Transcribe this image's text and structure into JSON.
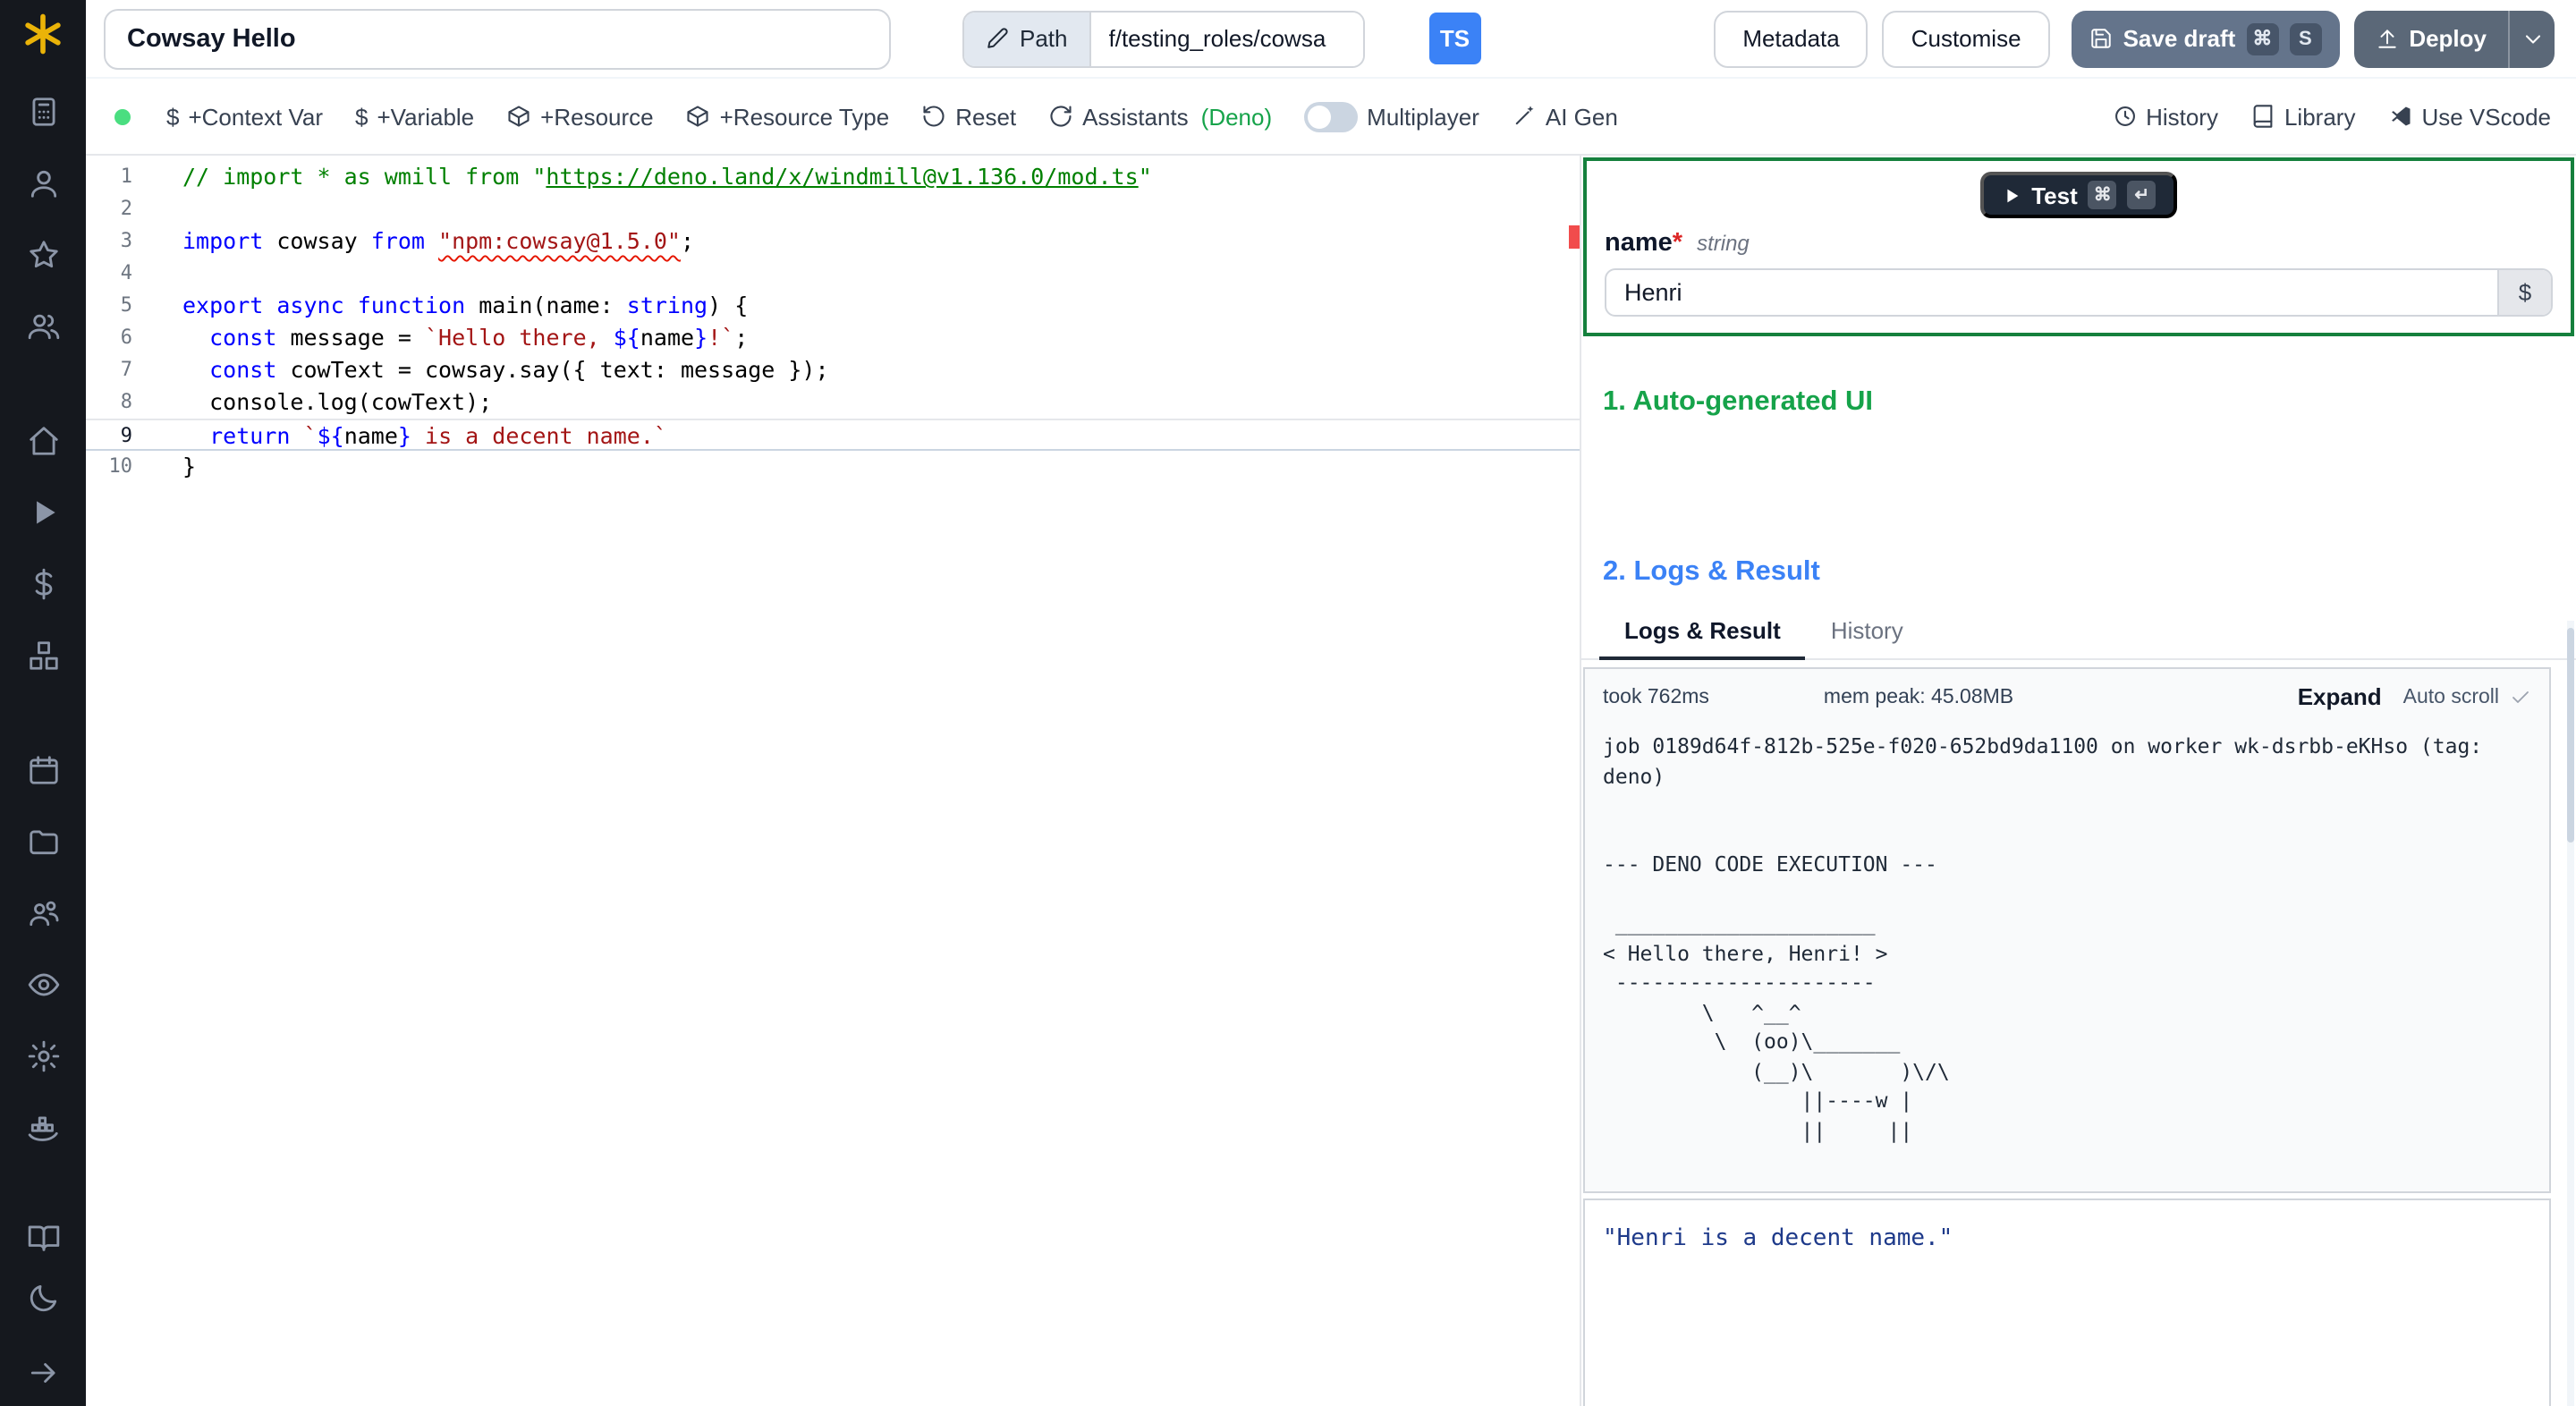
{
  "topbar": {
    "script_name": "Cowsay Hello",
    "path_label": "Path",
    "path_value": "f/testing_roles/cowsa",
    "language_badge": "TS",
    "metadata": "Metadata",
    "customise": "Customise",
    "save_draft": "Save draft",
    "save_kbd": [
      "⌘",
      "S"
    ],
    "deploy": "Deploy"
  },
  "toolbar": {
    "context_var": "+Context Var",
    "variable": "+Variable",
    "resource": "+Resource",
    "resource_type": "+Resource Type",
    "reset": "Reset",
    "assistants": "Assistants",
    "assistants_lang": "(Deno)",
    "multiplayer": "Multiplayer",
    "ai_gen": "AI Gen",
    "history": "History",
    "library": "Library",
    "use_vscode": "Use VScode"
  },
  "editor": {
    "active_line": 9,
    "lines": [
      [
        [
          "// import * as wmill from \"",
          "cm"
        ],
        [
          "https://deno.land/x/windmill@v1.136.0/mod.ts",
          "cm u"
        ],
        [
          "\"",
          "cm"
        ]
      ],
      [],
      [
        [
          "import",
          "kw"
        ],
        [
          " cowsay ",
          "id"
        ],
        [
          "from",
          "kw"
        ],
        [
          " ",
          "id"
        ],
        [
          "\"npm:cowsay@1.5.0\"",
          "str sq"
        ],
        [
          ";",
          "id"
        ]
      ],
      [],
      [
        [
          "export",
          "kw"
        ],
        [
          " ",
          "id"
        ],
        [
          "async",
          "kw"
        ],
        [
          " ",
          "id"
        ],
        [
          "function",
          "kw"
        ],
        [
          " main(name: ",
          "id"
        ],
        [
          "string",
          "kw"
        ],
        [
          ") {",
          "id"
        ]
      ],
      [
        [
          "  ",
          "id"
        ],
        [
          "const",
          "kw"
        ],
        [
          " message = ",
          "id"
        ],
        [
          "`Hello there, ",
          "str"
        ],
        [
          "${",
          "kw"
        ],
        [
          "name",
          "id"
        ],
        [
          "}",
          "kw"
        ],
        [
          "!`",
          "str"
        ],
        [
          ";",
          "id"
        ]
      ],
      [
        [
          "  ",
          "id"
        ],
        [
          "const",
          "kw"
        ],
        [
          " cowText = cowsay.say({ text: message });",
          "id"
        ]
      ],
      [
        [
          "  console.log(cowText);",
          "id"
        ]
      ],
      [
        [
          "  ",
          "id"
        ],
        [
          "return",
          "kw"
        ],
        [
          " ",
          "id"
        ],
        [
          "`",
          "str"
        ],
        [
          "${",
          "kw"
        ],
        [
          "name",
          "id"
        ],
        [
          "}",
          "kw"
        ],
        [
          " is a decent name.`",
          "str"
        ]
      ],
      [
        [
          "}",
          "id"
        ]
      ]
    ]
  },
  "run_panel": {
    "test_label": "Test",
    "test_kbd": [
      "⌘",
      "↵"
    ],
    "field_name": "name",
    "field_required": "*",
    "field_type": "string",
    "field_value": "Henri",
    "var_picker": "$",
    "section1": "1. Auto-generated UI",
    "section2": "2. Logs & Result",
    "tabs": [
      "Logs & Result",
      "History"
    ],
    "active_tab": "Logs & Result",
    "took": "took 762ms",
    "mem": "mem peak: 45.08MB",
    "expand": "Expand",
    "autoscroll": "Auto scroll",
    "log_text": "job 0189d64f-812b-525e-f020-652bd9da1100 on worker wk-dsrbb-eKHso (tag:\ndeno)\n\n\n--- DENO CODE EXECUTION ---\n\n _____________________\n< Hello there, Henri! >\n ---------------------\n        \\   ^__^\n         \\  (oo)\\_______\n            (__)\\       )\\/\\\n                ||----w |\n                ||     ||",
    "result_text": "\"Henri is a decent name.\""
  },
  "sidebar": {
    "groups": [
      [
        "calculator",
        "user",
        "star",
        "users"
      ],
      [
        "home",
        "play",
        "dollar",
        "boxes"
      ],
      [
        "calendar",
        "folder",
        "user-group",
        "eye",
        "settings",
        "worker"
      ]
    ],
    "bottom": [
      "book-open",
      "moon"
    ],
    "footer": [
      "arrow-right"
    ]
  },
  "icons": {
    "windmill-logo": "yellow pinwheel asterisk",
    "pencil": "edit pencil stroke",
    "save": "floppy disk stroke",
    "deploy": "upload arrow stroke",
    "chevron-down": "v stroke",
    "dollar": "$",
    "package": "cube stroke",
    "reset": "rotate-ccw arrow",
    "assistants": "refresh-cw arrows",
    "ai-wand": "line plus sparkle",
    "history": "clock",
    "library": "book",
    "vscode": "code ribbon",
    "play": "filled triangle",
    "check": "checkmark"
  },
  "colors": {
    "sidebar_bg": "#15181e",
    "status_dot": "#4ade80",
    "form_border": "#15803d",
    "heading_green": "#16a34a",
    "heading_blue": "#3b82f6",
    "keyword": "#0000ff",
    "string": "#a31515",
    "comment": "#008000",
    "error_mark": "#f14c4c",
    "ts_badge": "#3b82f6",
    "save_button": "#64748b",
    "deploy_button": "#5b6878",
    "result_text": "#1e3a8a"
  }
}
